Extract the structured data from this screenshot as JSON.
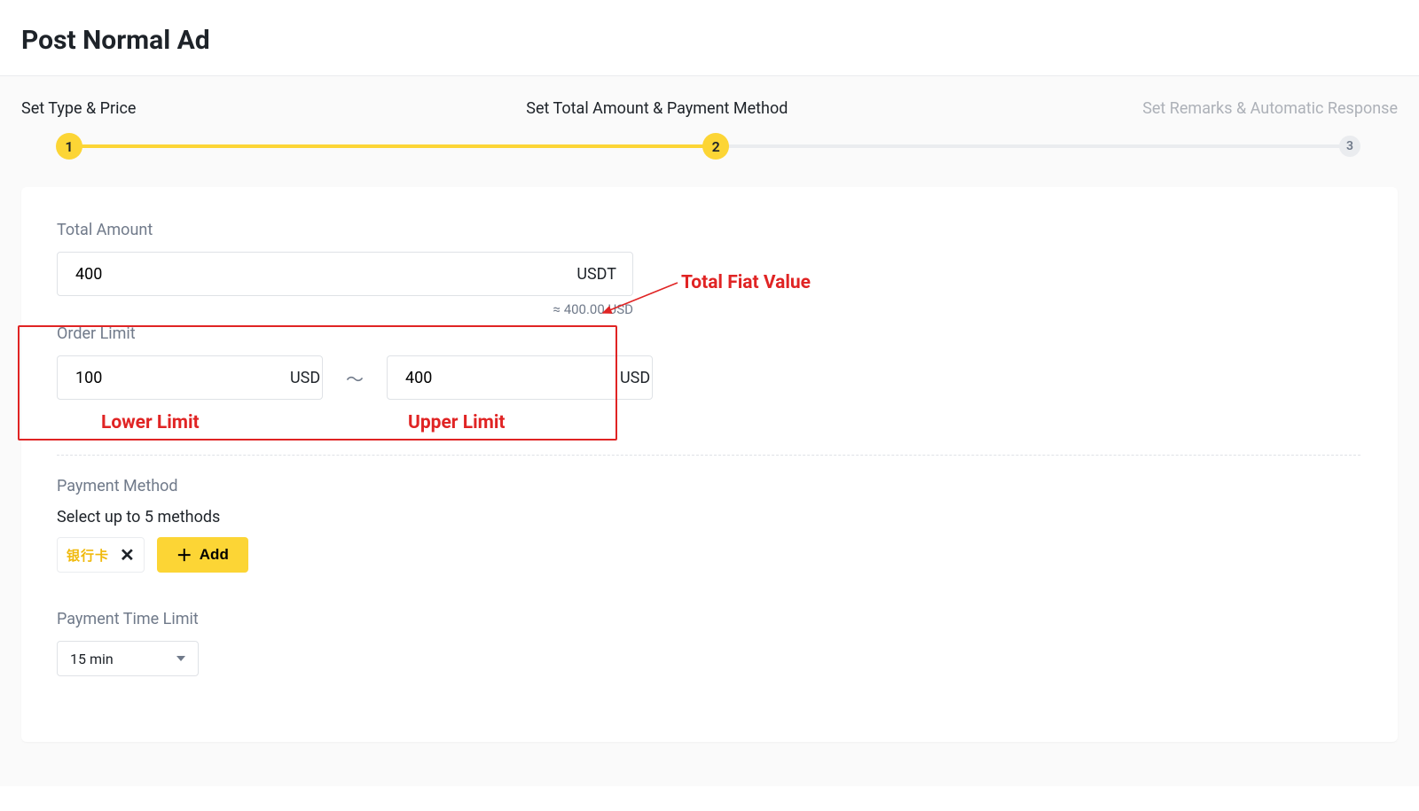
{
  "header": {
    "title": "Post Normal Ad"
  },
  "steps": {
    "labels": [
      "Set Type & Price",
      "Set Total Amount & Payment Method",
      "Set Remarks & Automatic Response"
    ],
    "numbers": [
      "1",
      "2",
      "3"
    ]
  },
  "form": {
    "total_amount": {
      "label": "Total Amount",
      "value": "400",
      "unit": "USDT",
      "approx": "≈ 400.00 USD"
    },
    "order_limit": {
      "label": "Order Limit",
      "lower": {
        "value": "100",
        "unit": "USD"
      },
      "upper": {
        "value": "400",
        "unit": "USD"
      },
      "tilde": "～"
    },
    "payment_method": {
      "label": "Payment Method",
      "sub": "Select up to 5 methods",
      "chip": "银行卡",
      "add": "Add"
    },
    "time_limit": {
      "label": "Payment Time Limit",
      "selected": "15 min"
    }
  },
  "annotations": {
    "total_fiat": "Total Fiat Value",
    "lower": "Lower Limit",
    "upper": "Upper Limit"
  }
}
